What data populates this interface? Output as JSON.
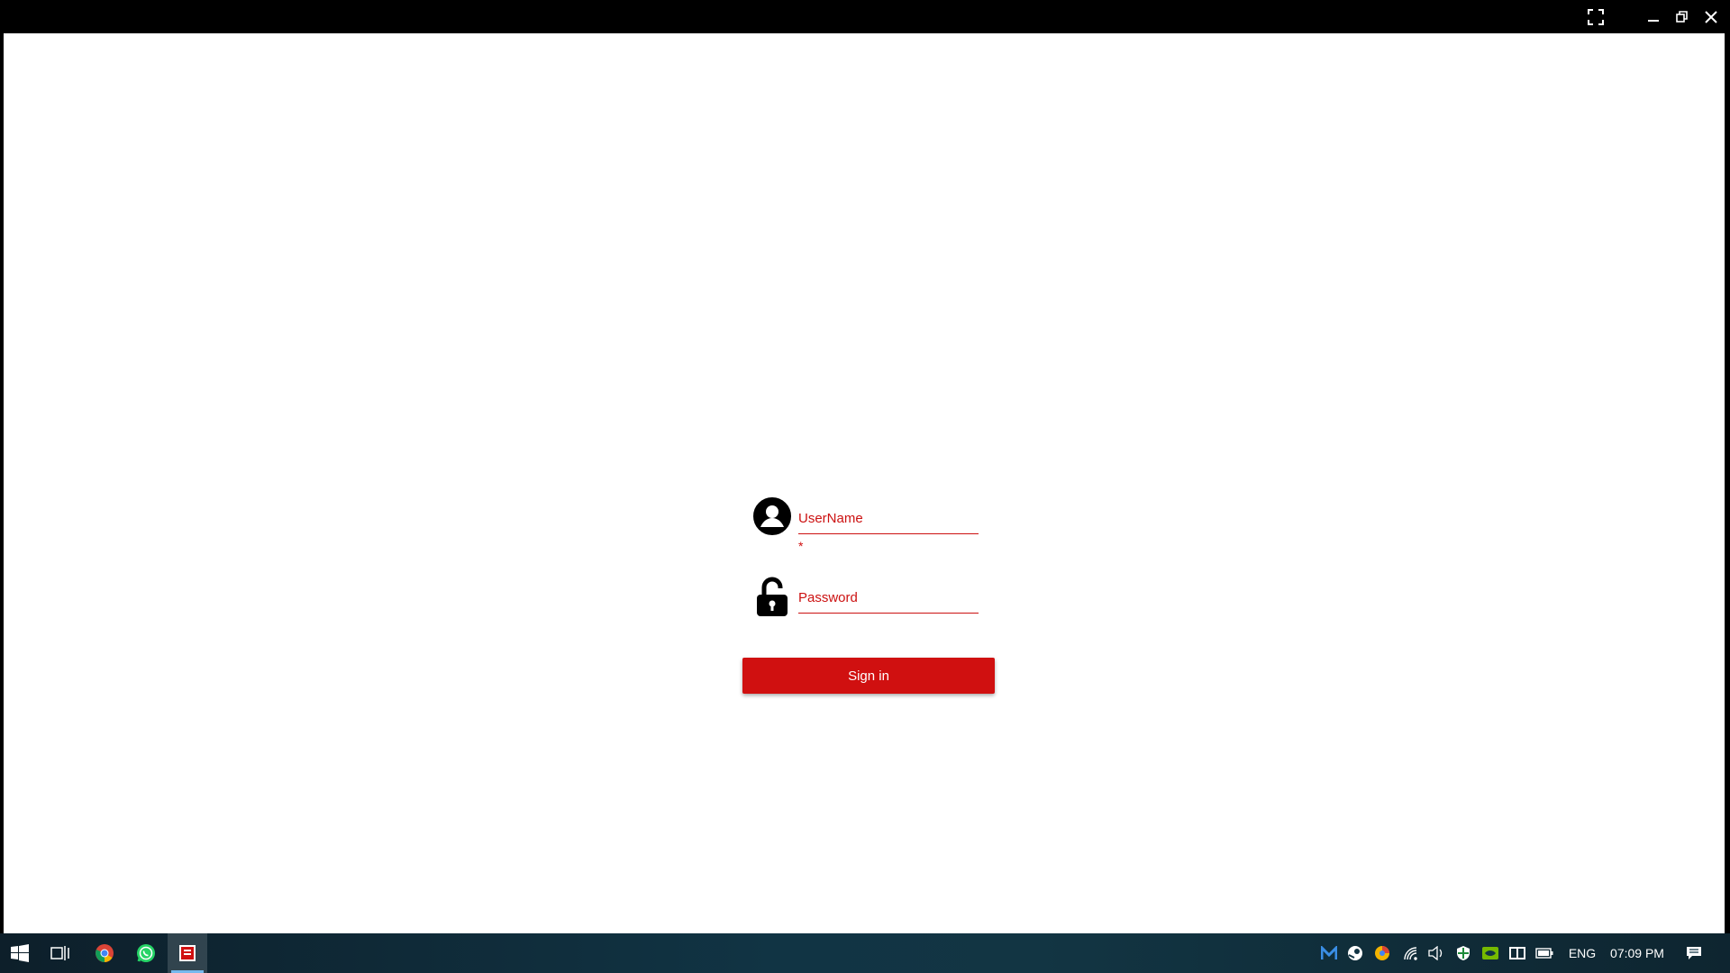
{
  "colors": {
    "accent": "#d01010",
    "titlebar": "#000000",
    "taskbar": "#113444",
    "taskbar_active_indicator": "#76b9ed"
  },
  "titlebar": {
    "icons": [
      "fullscreen-icon",
      "minimize-icon",
      "restore-icon",
      "close-icon"
    ]
  },
  "login": {
    "username": {
      "placeholder": "UserName",
      "value": "",
      "required_mark": "*"
    },
    "password": {
      "placeholder": "Password",
      "value": ""
    },
    "submit_label": "Sign in"
  },
  "taskbar": {
    "apps": [
      "windows-start-icon",
      "task-view-icon",
      "chrome-icon",
      "whatsapp-icon",
      "app-icon"
    ],
    "tray_icons": [
      "malwarebytes-icon",
      "steam-icon",
      "colorful-app-icon",
      "wifi-icon",
      "volume-icon",
      "security-icon",
      "nvidia-icon",
      "display-icon",
      "battery-icon"
    ],
    "language": "ENG",
    "time": "07:09 PM",
    "notification_icon": "action-center-icon"
  }
}
